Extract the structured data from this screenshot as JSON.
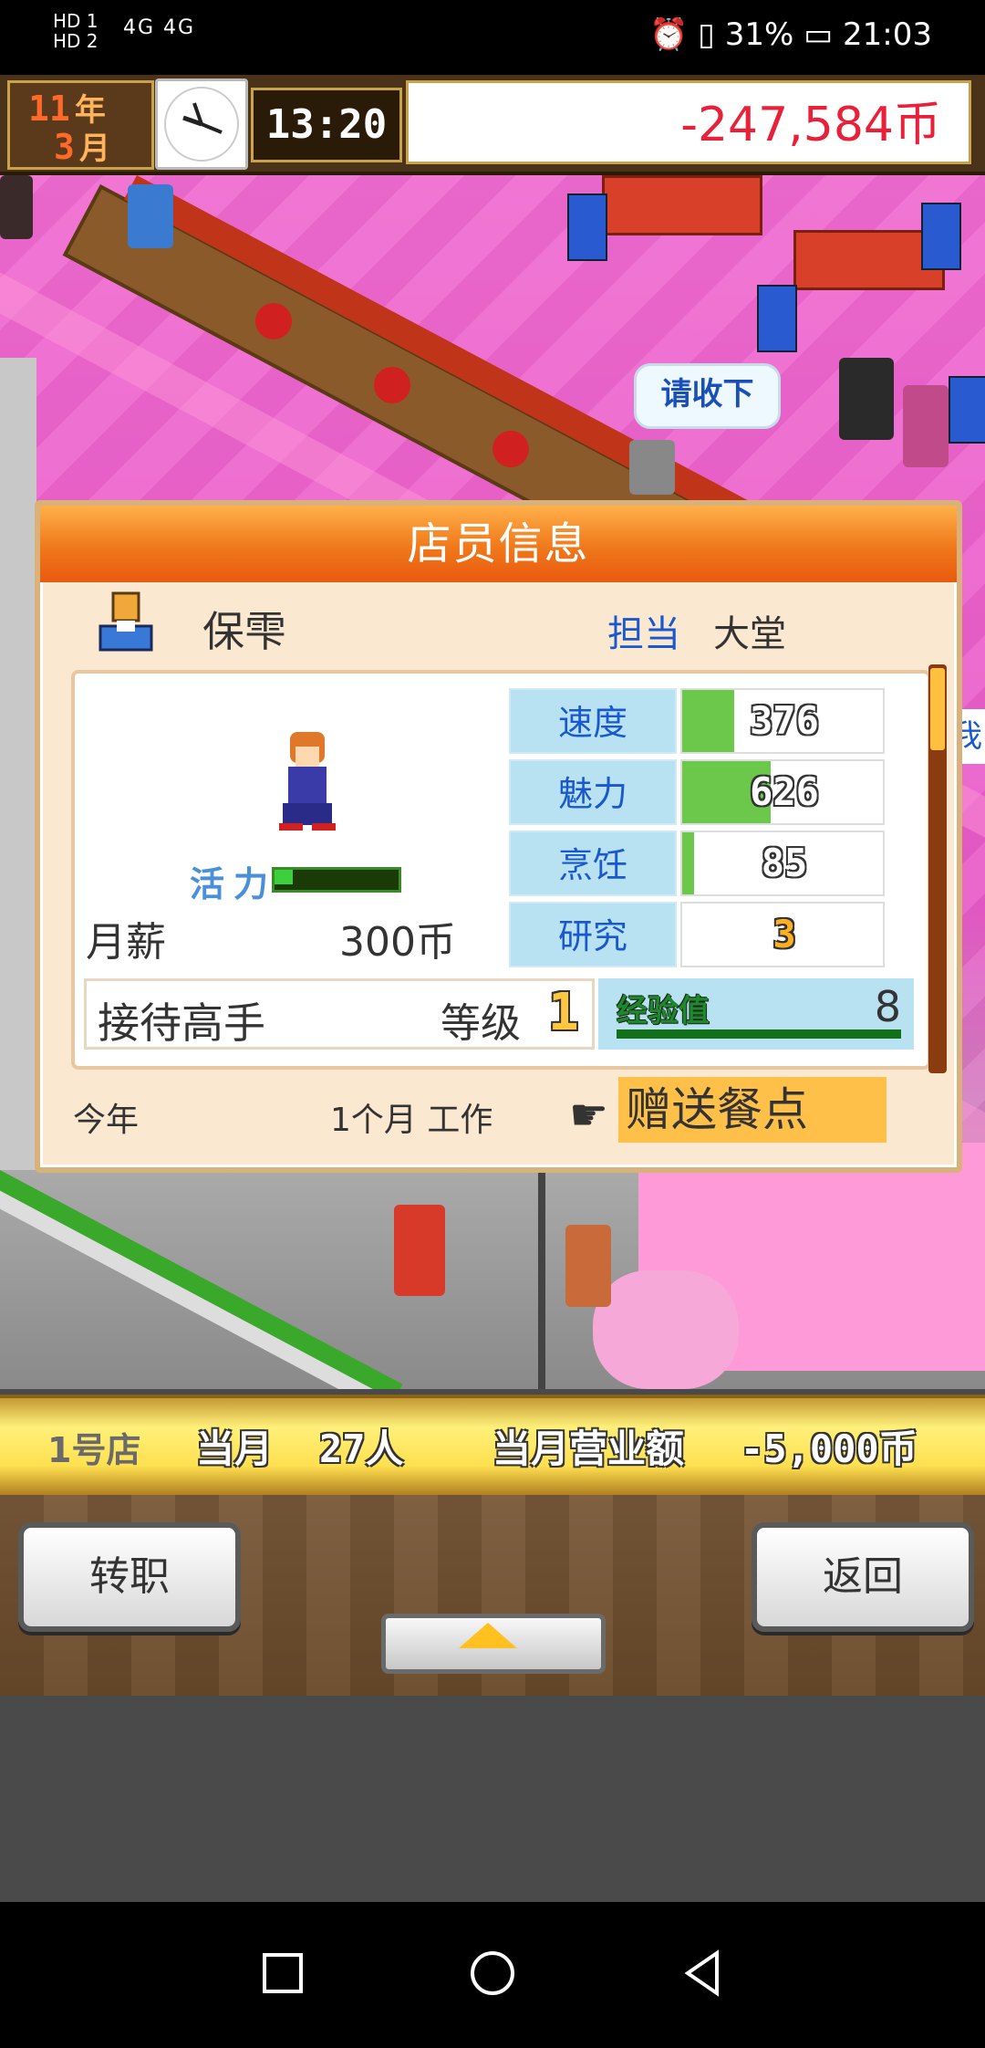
{
  "status_bar": {
    "network_left": "HD 1\nHD 2",
    "signal": "4G 4G",
    "battery": "31%",
    "time": "21:03"
  },
  "top_bar": {
    "year_num": "11",
    "year_unit": "年",
    "month_num": "3",
    "month_unit": "月",
    "game_time": "13:20",
    "money": "-247,584币"
  },
  "scene": {
    "bubble_text": "请收下",
    "edge_text": "我"
  },
  "dialog": {
    "title": "店员信息",
    "staff_name": "保雫",
    "role_label": "担当",
    "role_value": "大堂",
    "vitality_label": "活力",
    "vitality_level": 0.15,
    "salary_label": "月薪",
    "salary_value": "300币",
    "stats": [
      {
        "name": "速度",
        "value": "376",
        "fill": 0.26
      },
      {
        "name": "魅力",
        "value": "626",
        "fill": 0.44
      },
      {
        "name": "烹饪",
        "value": "85",
        "fill": 0.06
      },
      {
        "name": "研究",
        "value": "3",
        "fill": 0.0
      }
    ],
    "skill_name": "接待高手",
    "skill_level_label": "等级",
    "skill_level_value": "1",
    "exp_label": "经验值",
    "exp_value": "8",
    "year_label": "今年",
    "work_label": "1个月 工作",
    "gift_button": "赠送餐点"
  },
  "info_bar": {
    "store": "1号店",
    "month_label": "当月",
    "customers": "27人",
    "revenue_label": "当月营业额",
    "revenue_value": "-5,000币"
  },
  "controls": {
    "transfer_button": "转职",
    "back_button": "返回"
  },
  "colors": {
    "money_red": "#e8203a",
    "title_orange": "#f0781a",
    "stat_blue": "#1a58d0",
    "stat_fill_green": "#6cc84a",
    "gift_yellow": "#ffc04a"
  }
}
